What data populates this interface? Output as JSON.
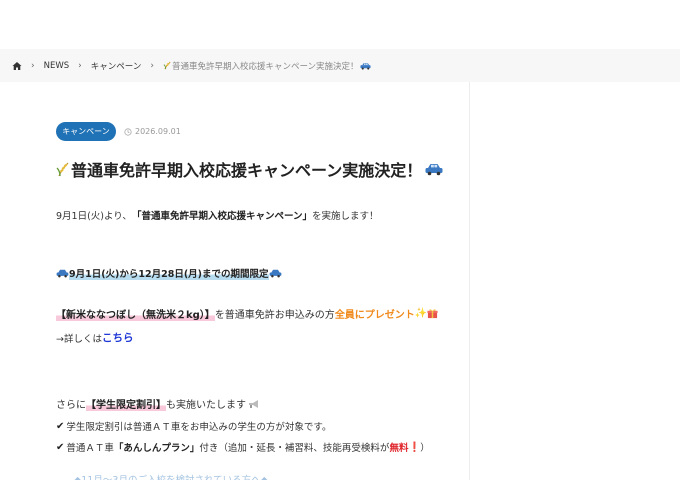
{
  "breadcrumb": {
    "items": [
      "NEWS",
      "キャンペーン"
    ],
    "current": "普通車免許早期入校応援キャンペーン実施決定！"
  },
  "post": {
    "category": "キャンペーン",
    "date": "2026.09.01",
    "title": "普通車免許早期入校応援キャンペーン実施決定！",
    "intro_before": "9月1日(火)より、",
    "intro_bold": "「普通車免許早期入校応援キャンペーン」",
    "intro_after": "を実施します！",
    "period": "9月1日(火)から12月28日(月)までの期間限定",
    "gift_item": "【新米ななつぼし（無洗米２kg）】",
    "gift_middle": "を普通車免許お申込みの方",
    "gift_highlight": "全員にプレゼント",
    "details_prefix": "→詳しくは",
    "details_link": "こちら",
    "student_before": "さらに",
    "student_bold": "【学生限定割引】",
    "student_after": "も実施いたします",
    "bullet1": "学生限定割引は普通ＡＴ車をお申込みの学生の方が対象です。",
    "bullet2_before": "普通ＡＴ車",
    "bullet2_bold": "「あんしんプラン」",
    "bullet2_middle": "付き（追加・延長・補習料、技能再受検料が",
    "bullet2_red": "無料",
    "bullet2_after": "）",
    "partial_line": "◆11月～3月のご入校を検討されている方へ◆"
  },
  "colors": {
    "badge_bg": "#1f72b5",
    "orange_text": "#f08a1c",
    "link_blue": "#1f37d6",
    "red_text": "#e0282d",
    "marker_blue": "#b8dcef",
    "marker_pink": "#f7c9da",
    "breadcrumb_bg": "#f7f7f8"
  },
  "icons": [
    "home-icon",
    "chevron-right-icon",
    "clock-icon",
    "rice-ear-icon",
    "car-icon",
    "sparkles-icon",
    "gift-icon",
    "megaphone-icon",
    "check-icon",
    "exclamation-icon"
  ]
}
